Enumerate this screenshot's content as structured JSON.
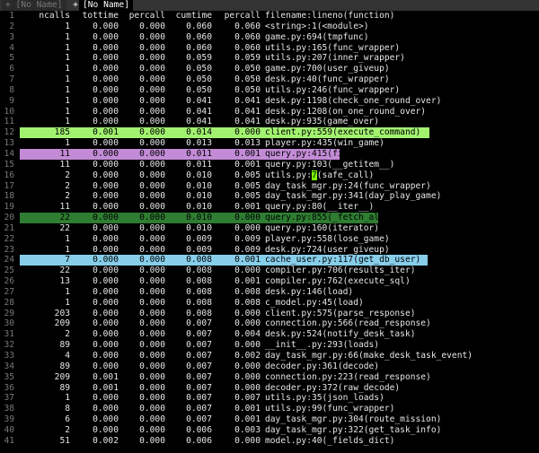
{
  "tabs": {
    "inactive": "+ [No Name]",
    "plus": "+",
    "active": "[No Name]"
  },
  "header": {
    "ln": "1",
    "ncalls": "ncalls",
    "tottime": "tottime",
    "percall": "percall",
    "cumtime": "cumtime",
    "percall2": "percall",
    "filename": "filename:lineno(function)"
  },
  "highlight_colors": {
    "green": "#a2f270",
    "purple": "#c28bd6",
    "dark_green": "#2e7d32",
    "blue": "#87ceeb"
  },
  "rows": [
    {
      "ln": "2",
      "ncalls": "1",
      "tottime": "0.000",
      "percall": "0.000",
      "cumtime": "0.060",
      "percall2": "0.060",
      "fn": "<string>:1(<module>)",
      "hl": ""
    },
    {
      "ln": "3",
      "ncalls": "1",
      "tottime": "0.000",
      "percall": "0.000",
      "cumtime": "0.060",
      "percall2": "0.060",
      "fn": "game.py:694(tmpfunc)",
      "hl": ""
    },
    {
      "ln": "4",
      "ncalls": "1",
      "tottime": "0.000",
      "percall": "0.000",
      "cumtime": "0.060",
      "percall2": "0.060",
      "fn": "utils.py:165(func_wrapper)",
      "hl": ""
    },
    {
      "ln": "5",
      "ncalls": "1",
      "tottime": "0.000",
      "percall": "0.000",
      "cumtime": "0.059",
      "percall2": "0.059",
      "fn": "utils.py:207(inner_wrapper)",
      "hl": ""
    },
    {
      "ln": "6",
      "ncalls": "1",
      "tottime": "0.000",
      "percall": "0.000",
      "cumtime": "0.050",
      "percall2": "0.050",
      "fn": "game.py:700(user_giveup)",
      "hl": ""
    },
    {
      "ln": "7",
      "ncalls": "1",
      "tottime": "0.000",
      "percall": "0.000",
      "cumtime": "0.050",
      "percall2": "0.050",
      "fn": "desk.py:40(func_wrapper)",
      "hl": ""
    },
    {
      "ln": "8",
      "ncalls": "1",
      "tottime": "0.000",
      "percall": "0.000",
      "cumtime": "0.050",
      "percall2": "0.050",
      "fn": "utils.py:246(func_wrapper)",
      "hl": ""
    },
    {
      "ln": "9",
      "ncalls": "1",
      "tottime": "0.000",
      "percall": "0.000",
      "cumtime": "0.041",
      "percall2": "0.041",
      "fn": "desk.py:1198(check_one_round_over)",
      "hl": ""
    },
    {
      "ln": "10",
      "ncalls": "1",
      "tottime": "0.000",
      "percall": "0.000",
      "cumtime": "0.041",
      "percall2": "0.041",
      "fn": "desk.py:1208(on_one_round_over)",
      "hl": ""
    },
    {
      "ln": "11",
      "ncalls": "1",
      "tottime": "0.000",
      "percall": "0.000",
      "cumtime": "0.041",
      "percall2": "0.041",
      "fn": "desk.py:935(game_over)",
      "hl": ""
    },
    {
      "ln": "12",
      "ncalls": "185",
      "tottime": "0.001",
      "percall": "0.000",
      "cumtime": "0.014",
      "percall2": "0.000",
      "fn": "client.py:559(execute_command)",
      "hl": "green"
    },
    {
      "ln": "13",
      "ncalls": "1",
      "tottime": "0.000",
      "percall": "0.000",
      "cumtime": "0.013",
      "percall2": "0.013",
      "fn": "player.py:435(win_game)",
      "hl": ""
    },
    {
      "ln": "14",
      "ncalls": "11",
      "tottime": "0.000",
      "percall": "0.000",
      "cumtime": "0.011",
      "percall2": "0.001",
      "fn": "query.py:415(first)",
      "hl": "purple"
    },
    {
      "ln": "15",
      "ncalls": "11",
      "tottime": "0.000",
      "percall": "0.000",
      "cumtime": "0.011",
      "percall2": "0.001",
      "fn": "query.py:103(__getitem__)",
      "hl": ""
    },
    {
      "ln": "16",
      "ncalls": "2",
      "tottime": "0.000",
      "percall": "0.000",
      "cumtime": "0.010",
      "percall2": "0.005",
      "fn_pre": "utils.py:",
      "fn_cursor": "7",
      "fn_post": "(safe_call)",
      "hl": ""
    },
    {
      "ln": "17",
      "ncalls": "2",
      "tottime": "0.000",
      "percall": "0.000",
      "cumtime": "0.010",
      "percall2": "0.005",
      "fn": "day_task_mgr.py:24(func_wrapper)",
      "hl": ""
    },
    {
      "ln": "18",
      "ncalls": "2",
      "tottime": "0.000",
      "percall": "0.000",
      "cumtime": "0.010",
      "percall2": "0.005",
      "fn": "day_task_mgr.py:341(day_play_game)",
      "hl": ""
    },
    {
      "ln": "19",
      "ncalls": "11",
      "tottime": "0.000",
      "percall": "0.000",
      "cumtime": "0.010",
      "percall2": "0.001",
      "fn": "query.py:80(__iter__)",
      "hl": ""
    },
    {
      "ln": "20",
      "ncalls": "22",
      "tottime": "0.000",
      "percall": "0.000",
      "cumtime": "0.010",
      "percall2": "0.000",
      "fn": "query.py:855(_fetch_all)",
      "hl": "dark_green"
    },
    {
      "ln": "21",
      "ncalls": "22",
      "tottime": "0.000",
      "percall": "0.000",
      "cumtime": "0.010",
      "percall2": "0.000",
      "fn": "query.py:160(iterator)",
      "hl": ""
    },
    {
      "ln": "22",
      "ncalls": "1",
      "tottime": "0.000",
      "percall": "0.000",
      "cumtime": "0.009",
      "percall2": "0.009",
      "fn": "player.py:558(lose_game)",
      "hl": ""
    },
    {
      "ln": "23",
      "ncalls": "1",
      "tottime": "0.000",
      "percall": "0.000",
      "cumtime": "0.009",
      "percall2": "0.009",
      "fn": "desk.py:724(user_giveup)",
      "hl": ""
    },
    {
      "ln": "24",
      "ncalls": "7",
      "tottime": "0.000",
      "percall": "0.000",
      "cumtime": "0.008",
      "percall2": "0.001",
      "fn": "cache_user.py:117(get_db_user)",
      "hl": "blue"
    },
    {
      "ln": "25",
      "ncalls": "22",
      "tottime": "0.000",
      "percall": "0.000",
      "cumtime": "0.008",
      "percall2": "0.000",
      "fn": "compiler.py:706(results_iter)",
      "hl": ""
    },
    {
      "ln": "26",
      "ncalls": "13",
      "tottime": "0.000",
      "percall": "0.000",
      "cumtime": "0.008",
      "percall2": "0.001",
      "fn": "compiler.py:762(execute_sql)",
      "hl": ""
    },
    {
      "ln": "27",
      "ncalls": "1",
      "tottime": "0.000",
      "percall": "0.000",
      "cumtime": "0.008",
      "percall2": "0.008",
      "fn": "desk.py:146(load)",
      "hl": ""
    },
    {
      "ln": "28",
      "ncalls": "1",
      "tottime": "0.000",
      "percall": "0.000",
      "cumtime": "0.008",
      "percall2": "0.008",
      "fn": "c_model.py:45(load)",
      "hl": ""
    },
    {
      "ln": "29",
      "ncalls": "203",
      "tottime": "0.000",
      "percall": "0.000",
      "cumtime": "0.008",
      "percall2": "0.000",
      "fn": "client.py:575(parse_response)",
      "hl": ""
    },
    {
      "ln": "30",
      "ncalls": "209",
      "tottime": "0.000",
      "percall": "0.000",
      "cumtime": "0.007",
      "percall2": "0.000",
      "fn": "connection.py:566(read_response)",
      "hl": ""
    },
    {
      "ln": "31",
      "ncalls": "2",
      "tottime": "0.000",
      "percall": "0.000",
      "cumtime": "0.007",
      "percall2": "0.004",
      "fn": "desk.py:524(notify_desk_task)",
      "hl": ""
    },
    {
      "ln": "32",
      "ncalls": "89",
      "tottime": "0.000",
      "percall": "0.000",
      "cumtime": "0.007",
      "percall2": "0.000",
      "fn": "__init__.py:293(loads)",
      "hl": ""
    },
    {
      "ln": "33",
      "ncalls": "4",
      "tottime": "0.000",
      "percall": "0.000",
      "cumtime": "0.007",
      "percall2": "0.002",
      "fn": "day_task_mgr.py:66(make_desk_task_event)",
      "hl": ""
    },
    {
      "ln": "34",
      "ncalls": "89",
      "tottime": "0.000",
      "percall": "0.000",
      "cumtime": "0.007",
      "percall2": "0.000",
      "fn": "decoder.py:361(decode)",
      "hl": ""
    },
    {
      "ln": "35",
      "ncalls": "209",
      "tottime": "0.001",
      "percall": "0.000",
      "cumtime": "0.007",
      "percall2": "0.000",
      "fn": "connection.py:223(read_response)",
      "hl": ""
    },
    {
      "ln": "36",
      "ncalls": "89",
      "tottime": "0.001",
      "percall": "0.000",
      "cumtime": "0.007",
      "percall2": "0.000",
      "fn": "decoder.py:372(raw_decode)",
      "hl": ""
    },
    {
      "ln": "37",
      "ncalls": "1",
      "tottime": "0.000",
      "percall": "0.000",
      "cumtime": "0.007",
      "percall2": "0.007",
      "fn": "utils.py:35(json_loads)",
      "hl": ""
    },
    {
      "ln": "38",
      "ncalls": "8",
      "tottime": "0.000",
      "percall": "0.000",
      "cumtime": "0.007",
      "percall2": "0.001",
      "fn": "utils.py:99(func_wrapper)",
      "hl": ""
    },
    {
      "ln": "39",
      "ncalls": "6",
      "tottime": "0.000",
      "percall": "0.000",
      "cumtime": "0.007",
      "percall2": "0.001",
      "fn": "day_task_mgr.py:304(route_mission)",
      "hl": ""
    },
    {
      "ln": "40",
      "ncalls": "2",
      "tottime": "0.000",
      "percall": "0.000",
      "cumtime": "0.006",
      "percall2": "0.003",
      "fn": "day_task_mgr.py:322(get_task_info)",
      "hl": ""
    },
    {
      "ln": "41",
      "ncalls": "51",
      "tottime": "0.002",
      "percall": "0.000",
      "cumtime": "0.006",
      "percall2": "0.000",
      "fn": "model.py:40(_fields_dict)",
      "hl": ""
    }
  ]
}
